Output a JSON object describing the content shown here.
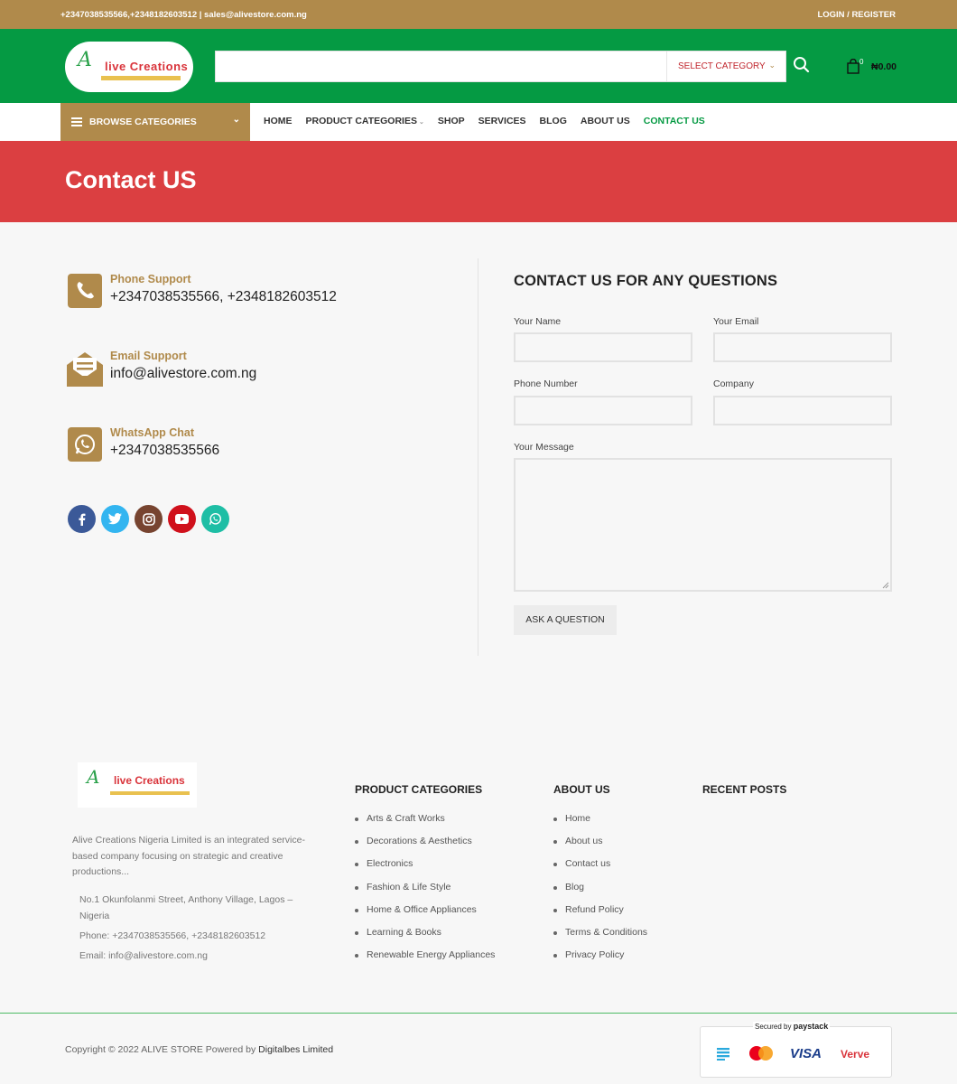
{
  "topbar": {
    "contacts": "+2347038535566,+2348182603512 | sales@alivestore.com.ng",
    "login": "LOGIN / REGISTER"
  },
  "header": {
    "logo_alt": "Alive Creations",
    "search": {
      "placeholder": "",
      "category": "SELECT CATEGORY"
    },
    "cart": {
      "count": "0",
      "total": "₦0.00"
    }
  },
  "nav": {
    "browse": "BROWSE CATEGORIES",
    "items": [
      {
        "label": "HOME"
      },
      {
        "label": "PRODUCT CATEGORIES"
      },
      {
        "label": "SHOP"
      },
      {
        "label": "SERVICES"
      },
      {
        "label": "BLOG"
      },
      {
        "label": "ABOUT US"
      },
      {
        "label": "CONTACT US"
      }
    ]
  },
  "hero": {
    "title": "Contact US"
  },
  "contact": {
    "phone": {
      "title": "Phone Support",
      "value": "+2347038535566, +2348182603512"
    },
    "email": {
      "title": "Email Support",
      "value": "info@alivestore.com.ng"
    },
    "whatsapp": {
      "title": "WhatsApp Chat",
      "value": "+2347038535566"
    },
    "socials": [
      "facebook",
      "twitter",
      "instagram",
      "youtube",
      "whatsapp"
    ]
  },
  "form": {
    "title": "CONTACT US FOR ANY QUESTIONS",
    "name_label": "Your Name",
    "email_label": "Your Email",
    "phone_label": "Phone Number",
    "company_label": "Company",
    "message_label": "Your Message",
    "submit": "ASK A QUESTION"
  },
  "footer": {
    "description": "Alive Creations Nigeria Limited is an integrated service-based company focusing on strategic and creative productions...",
    "address": "No.1 Okunfolanmi Street, Anthony Village, Lagos – Nigeria",
    "phone": "Phone: +2347038535566, +2348182603512",
    "email": "Email: info@alivestore.com.ng",
    "product_categories": {
      "title": "PRODUCT CATEGORIES",
      "items": [
        "Arts & Craft Works",
        "Decorations & Aesthetics",
        "Electronics",
        "Fashion & Life Style",
        "Home & Office Appliances",
        "Learning & Books",
        "Renewable Energy Appliances"
      ]
    },
    "about": {
      "title": "ABOUT US",
      "items": [
        "Home",
        "About us",
        "Contact us",
        "Blog",
        "Refund Policy",
        "Terms & Conditions",
        "Privacy Policy"
      ]
    },
    "recent_posts": {
      "title": "RECENT POSTS"
    },
    "copyright": "Copyright © 2022 ALIVE STORE Powered by",
    "powered": "Digitalbes Limited",
    "secured": "Secured by",
    "secured_brand": "paystack",
    "visa": "VISA",
    "verve_v": "V",
    "verve_rest": "erve"
  },
  "colors": {
    "topbar": "#b08a4b",
    "header": "#059a43",
    "hero": "#db3f41",
    "accent": "#b08a4b"
  }
}
